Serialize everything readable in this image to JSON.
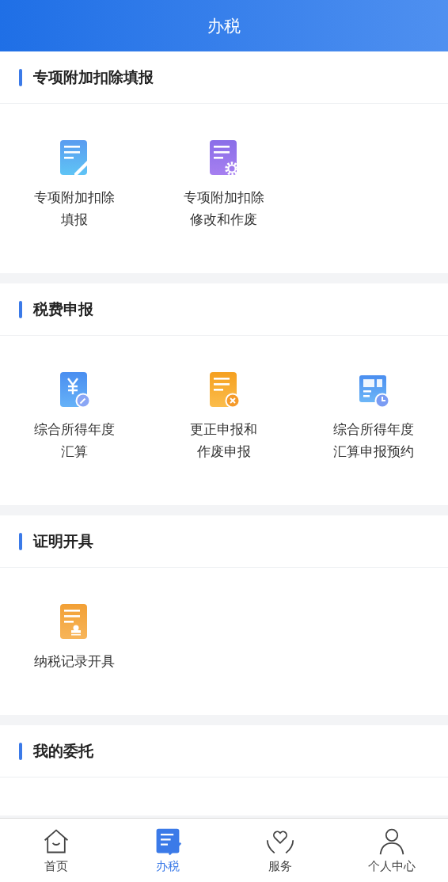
{
  "header": {
    "title": "办税"
  },
  "sections": [
    {
      "title": "专项附加扣除填报",
      "items": [
        {
          "kind": "edit",
          "lines": [
            "专项附加扣除",
            "填报"
          ]
        },
        {
          "kind": "gear",
          "lines": [
            "专项附加扣除",
            "修改和作废"
          ]
        }
      ]
    },
    {
      "title": "税费申报",
      "items": [
        {
          "kind": "yen",
          "lines": [
            "综合所得年度",
            "汇算"
          ]
        },
        {
          "kind": "cancel",
          "lines": [
            "更正申报和",
            "作废申报"
          ]
        },
        {
          "kind": "calendar",
          "lines": [
            "综合所得年度",
            "汇算申报预约"
          ]
        }
      ]
    },
    {
      "title": "证明开具",
      "items": [
        {
          "kind": "stamp",
          "lines": [
            "纳税记录开具"
          ]
        }
      ]
    },
    {
      "title": "我的委托"
    }
  ],
  "tabs": [
    {
      "kind": "home",
      "label": "首页",
      "selected": false
    },
    {
      "kind": "tax",
      "label": "办税",
      "selected": true
    },
    {
      "kind": "service",
      "label": "服务",
      "selected": false
    },
    {
      "kind": "user",
      "label": "个人中心",
      "selected": false
    }
  ]
}
